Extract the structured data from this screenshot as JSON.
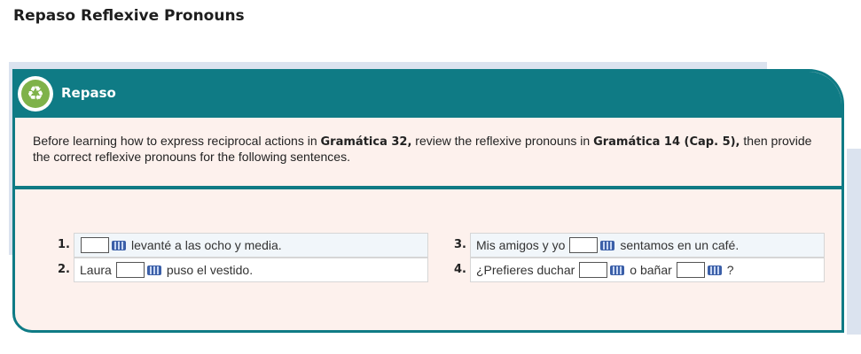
{
  "page": {
    "title": "Repaso Reflexive Pronouns"
  },
  "card": {
    "title": "Repaso",
    "instructions": {
      "p1": "Before learning how to express reciprocal actions in ",
      "b1": "Gramática 32,",
      "p2": " review the reflexive pronouns in ",
      "b2": "Gramática 14 (Cap. 5),",
      "p3": " then provide the correct reflexive pronouns for the following sentences."
    }
  },
  "items": [
    {
      "number": "1.",
      "before": "",
      "after": "levanté a las ocho y media."
    },
    {
      "number": "2.",
      "before": "Laura",
      "after": "puso el vestido."
    },
    {
      "number": "3.",
      "before": "Mis amigos y yo",
      "after": "sentamos en un café."
    },
    {
      "number": "4.",
      "before": "¿Prefieres duchar",
      "middle": "o bañar",
      "after": "?"
    }
  ],
  "colors": {
    "teal": "#0f7b85",
    "card_bg": "#fdf1ed",
    "band": "#dbe3ef",
    "recycle_green": "#7fb24a"
  },
  "icons": {
    "badge": "recycle-icon",
    "virtual_keyboard": "keyboard-icon"
  }
}
